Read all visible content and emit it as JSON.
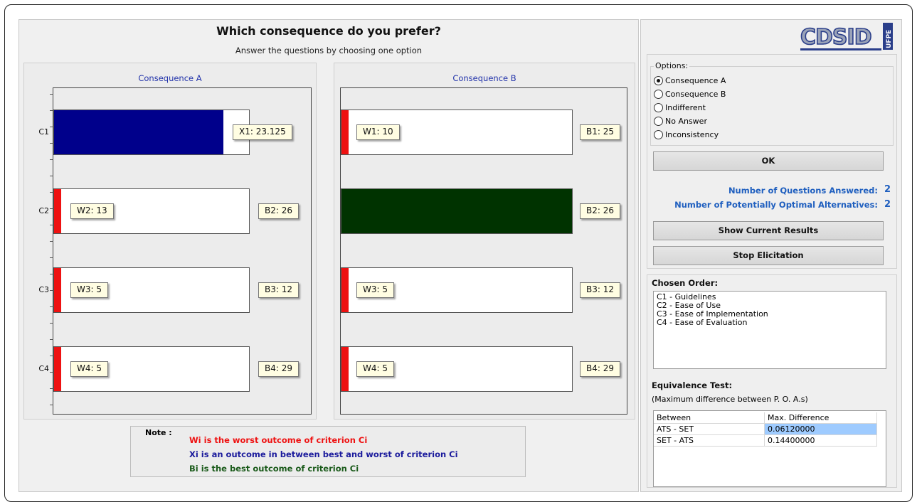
{
  "header": {
    "title": "Which consequence do you prefer?",
    "subtitle": "Answer the questions by choosing one option"
  },
  "colors": {
    "worst": "#ee1111",
    "intermediate": "#00008b",
    "best": "#003300",
    "link_blue": "#1f5fbf"
  },
  "consequence_a": {
    "label": "Consequence A",
    "criteria": [
      {
        "name": "C1",
        "left_tag": "X1: 23.125",
        "right_tag": "",
        "fill": "intermediate",
        "fill_fraction": 0.87
      },
      {
        "name": "C2",
        "left_tag": "W2: 13",
        "right_tag": "B2: 26",
        "fill": "worst"
      },
      {
        "name": "C3",
        "left_tag": "W3: 5",
        "right_tag": "B3: 12",
        "fill": "worst"
      },
      {
        "name": "C4",
        "left_tag": "W4: 5",
        "right_tag": "B4: 29",
        "fill": "worst"
      }
    ]
  },
  "consequence_b": {
    "label": "Consequence B",
    "criteria": [
      {
        "name": "C1",
        "left_tag": "W1: 10",
        "right_tag": "B1: 25",
        "fill": "worst"
      },
      {
        "name": "C2",
        "left_tag": "",
        "right_tag": "B2: 26",
        "fill": "best"
      },
      {
        "name": "C3",
        "left_tag": "W3: 5",
        "right_tag": "B3: 12",
        "fill": "worst"
      },
      {
        "name": "C4",
        "left_tag": "W4: 5",
        "right_tag": "B4: 29",
        "fill": "worst"
      }
    ]
  },
  "note": {
    "title": "Note :",
    "worst_text": "Wi is the worst outcome of criterion Ci",
    "intermediate_text": "Xi is an outcome in between best and worst of criterion Ci",
    "best_text": "Bi is the best outcome of criterion Ci"
  },
  "logo": {
    "text": "CDSID",
    "side_text": "UFPE"
  },
  "options": {
    "legend": "Options:",
    "items": [
      "Consequence A",
      "Consequence B",
      "Indifferent",
      "No Answer",
      "Inconsistency"
    ],
    "selected": "Consequence A"
  },
  "ok_button": "OK",
  "stats": {
    "questions_label": "Number of Questions Answered:",
    "questions_value": "2",
    "alternatives_label": "Number of Potentially Optimal Alternatives:",
    "alternatives_value": "2"
  },
  "show_results_button": "Show Current Results",
  "stop_button": "Stop Elicitation",
  "chosen_order": {
    "title": "Chosen Order:",
    "items": [
      "C1 - Guidelines",
      "C2 - Ease of Use",
      "C3 - Ease of Implementation",
      "C4 - Ease of Evaluation"
    ]
  },
  "equivalence": {
    "title": "Equivalence Test:",
    "subtitle": "(Maximum difference between P. O. A.s)",
    "headers": [
      "Between",
      "Max. Difference"
    ],
    "rows": [
      [
        "ATS - SET",
        "0.06120000"
      ],
      [
        "SET - ATS",
        "0.14400000"
      ]
    ]
  }
}
